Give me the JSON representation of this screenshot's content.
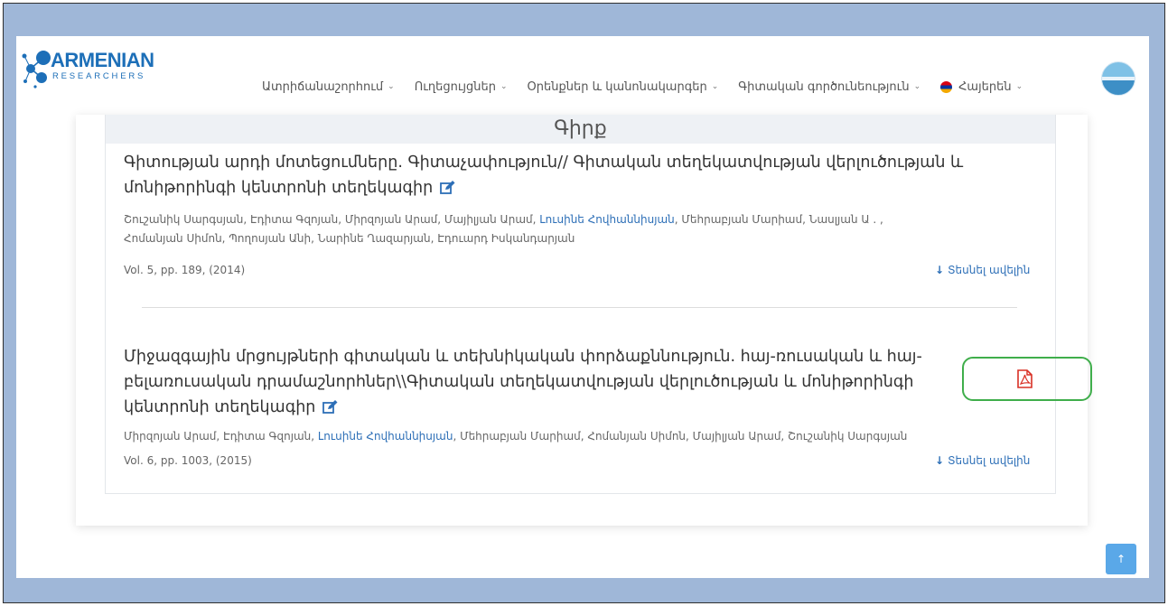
{
  "logo": {
    "top_text": "ARMENIAN",
    "bottom_text": "RESEARCHERS"
  },
  "nav": {
    "items": [
      {
        "label": "Ատրիճանաշnրhnւմ"
      },
      {
        "label": "Ուղեցույցներ"
      },
      {
        "label": "Օրենքներ և կանոնակարգեր"
      },
      {
        "label": "Գիտական գործունեություն"
      }
    ],
    "language": "Հայերեն"
  },
  "section": {
    "heading": "Գիրք"
  },
  "items": [
    {
      "title_line1": "Գիտության արդի մոտեցումները. Գիտաչափություն// Գիտական տեղեկատվության վերլուծության և",
      "title_line2": "մոնիթորինգի կենտրոնի տեղեկագիր",
      "authors_before": "Շուշանիկ Սարգսյան, Էդիտա Գզոյան, Միրզոյան Արամ, Մայիլյան Արամ, ",
      "authors_highlight": "Լուսինե Հովհաննիսյան",
      "authors_after": ", Մեհրաբյան Մարիամ, Նասլյան Ա . ,",
      "authors_line2": "Հոմանյան Սիմոն, Պողոսյան Անի, Նարինե Ղազարյան, Էդուարդ Իսկանդարյան",
      "vol": "Vol. 5, pp. 189, (2014)",
      "more": "Տեսնել ավելին"
    },
    {
      "title_line1": "Միջազգային մրցույթների գիտական և տեխնիկական փորձաքննություն. հայ-ռուսական և հայ-",
      "title_line2": "բելառուսական դրամաշնորհներ\\\\Գիտական տեղեկատվության վերլուծության և մոնիթորինգի",
      "title_line3": "կենտրոնի տեղեկագիր",
      "authors_before": "Միրզոյան Արամ, Էդիտա Գզոյան, ",
      "authors_highlight": "Լուսինե Հովհաննիսյան",
      "authors_after": ", Մեհրաբյան Մարիամ, Հոմանյան Սիմոն, Մայիլյան Արամ, Շուշանիկ Սարգսյան",
      "vol": "Vol. 6, pp. 1003, (2015)",
      "more": "Տեսնել ավելին"
    }
  ],
  "colors": {
    "link": "#2d6fb7",
    "highlight_box": "#3fae4b",
    "pdf_red": "#d93025",
    "scroll_btn": "#5aa8e8"
  }
}
